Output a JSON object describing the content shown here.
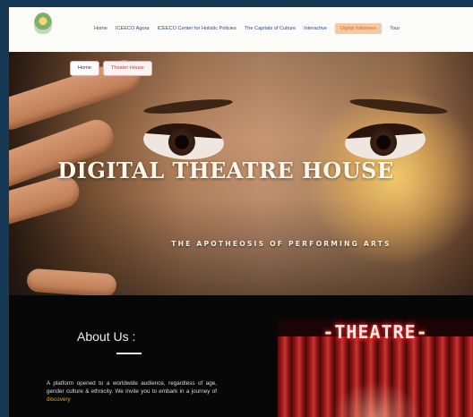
{
  "nav": {
    "logo_text": "",
    "faded_text": "",
    "links": [
      "Home",
      "ICEECO Agora",
      "ICEECO Center for Holistic Policies",
      "The Capitals of Culture",
      "Interactive",
      "Digital Initiatives",
      "Tour"
    ],
    "active_index": 5
  },
  "breadcrumb": {
    "home": "Home",
    "current": "Theater House"
  },
  "hero": {
    "title": "DIGITAL THEATRE HOUSE",
    "subtitle": "THE APOTHEOSIS OF PERFORMING ARTS"
  },
  "about": {
    "title": "About Us :",
    "text_before": "A platform opened to a worldwide audience, regardless of age, gender culture & ethnicity. We invite you to embark in a journey of ",
    "text_highlight": "discovery"
  },
  "theatre_image": {
    "marquee": "-THEATRE-"
  },
  "colors": {
    "frame_bg": "#163a55",
    "nav_active_bg": "#f6c9a3",
    "nav_active_text": "#d06d2a",
    "highlight": "#e2a43c",
    "crumb_current": "#c73a3a"
  }
}
